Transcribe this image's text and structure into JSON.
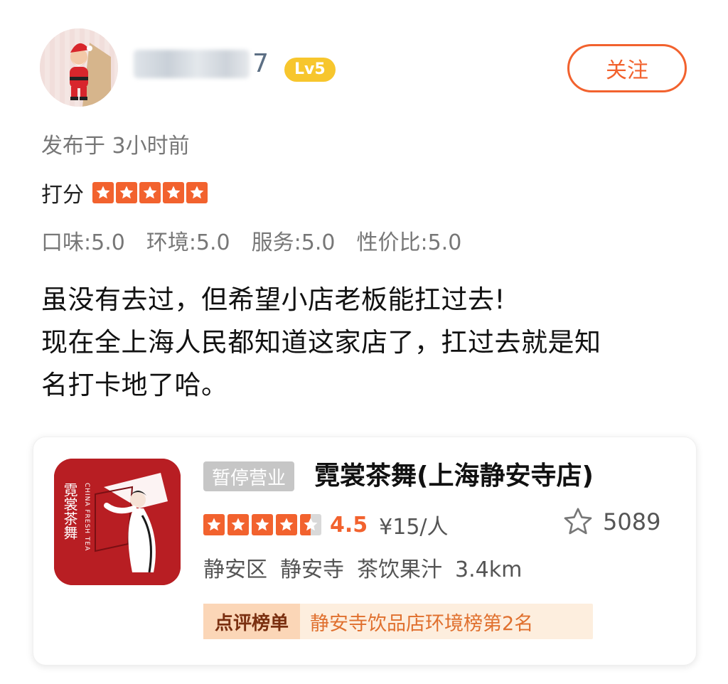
{
  "user": {
    "name_tail": "7",
    "level": "Lv5",
    "follow_label": "关注"
  },
  "post": {
    "time": "发布于 3小时前",
    "rating_label": "打分",
    "rating_stars": 5,
    "subscores": [
      "口味:5.0",
      "环境:5.0",
      "服务:5.0",
      "性价比:5.0"
    ],
    "text_lines": [
      "虽没有去过，但希望小店老板能扛过去!",
      "现在全上海人民都知道这家店了，扛过去就是知",
      "名打卡地了哈。"
    ]
  },
  "shop": {
    "status_tag": "暂停营业",
    "name": "霓裳茶舞(上海静安寺店)",
    "score": "4.5",
    "stars": 4.5,
    "price": "¥15/人",
    "favorites": "5089",
    "tags": [
      "静安区",
      "静安寺",
      "茶饮果汁",
      "3.4km"
    ],
    "rank_label": "点评榜单",
    "rank_text": "静安寺饮品店环境榜第2名",
    "logo_text": {
      "cn": "霓裳茶舞",
      "en": "CHINA FRESH TEA"
    }
  },
  "colors": {
    "accent": "#f2622e",
    "level_badge": "#f7c62d",
    "logo_red": "#b81e23"
  },
  "icons": {
    "star": "star-icon",
    "favorite": "star-outline-icon"
  }
}
